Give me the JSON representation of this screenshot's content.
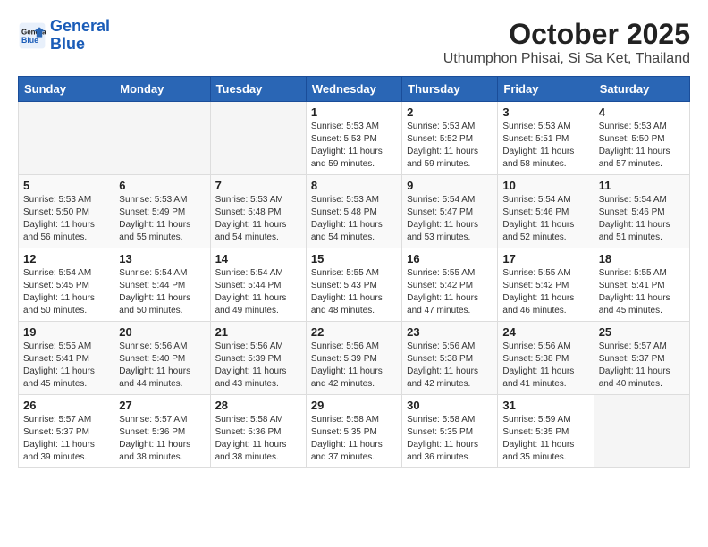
{
  "header": {
    "logo_line1": "General",
    "logo_line2": "Blue",
    "title": "October 2025",
    "subtitle": "Uthumphon Phisai, Si Sa Ket, Thailand"
  },
  "calendar": {
    "columns": [
      "Sunday",
      "Monday",
      "Tuesday",
      "Wednesday",
      "Thursday",
      "Friday",
      "Saturday"
    ],
    "weeks": [
      [
        {
          "day": "",
          "info": ""
        },
        {
          "day": "",
          "info": ""
        },
        {
          "day": "",
          "info": ""
        },
        {
          "day": "1",
          "info": "Sunrise: 5:53 AM\nSunset: 5:53 PM\nDaylight: 11 hours\nand 59 minutes."
        },
        {
          "day": "2",
          "info": "Sunrise: 5:53 AM\nSunset: 5:52 PM\nDaylight: 11 hours\nand 59 minutes."
        },
        {
          "day": "3",
          "info": "Sunrise: 5:53 AM\nSunset: 5:51 PM\nDaylight: 11 hours\nand 58 minutes."
        },
        {
          "day": "4",
          "info": "Sunrise: 5:53 AM\nSunset: 5:50 PM\nDaylight: 11 hours\nand 57 minutes."
        }
      ],
      [
        {
          "day": "5",
          "info": "Sunrise: 5:53 AM\nSunset: 5:50 PM\nDaylight: 11 hours\nand 56 minutes."
        },
        {
          "day": "6",
          "info": "Sunrise: 5:53 AM\nSunset: 5:49 PM\nDaylight: 11 hours\nand 55 minutes."
        },
        {
          "day": "7",
          "info": "Sunrise: 5:53 AM\nSunset: 5:48 PM\nDaylight: 11 hours\nand 54 minutes."
        },
        {
          "day": "8",
          "info": "Sunrise: 5:53 AM\nSunset: 5:48 PM\nDaylight: 11 hours\nand 54 minutes."
        },
        {
          "day": "9",
          "info": "Sunrise: 5:54 AM\nSunset: 5:47 PM\nDaylight: 11 hours\nand 53 minutes."
        },
        {
          "day": "10",
          "info": "Sunrise: 5:54 AM\nSunset: 5:46 PM\nDaylight: 11 hours\nand 52 minutes."
        },
        {
          "day": "11",
          "info": "Sunrise: 5:54 AM\nSunset: 5:46 PM\nDaylight: 11 hours\nand 51 minutes."
        }
      ],
      [
        {
          "day": "12",
          "info": "Sunrise: 5:54 AM\nSunset: 5:45 PM\nDaylight: 11 hours\nand 50 minutes."
        },
        {
          "day": "13",
          "info": "Sunrise: 5:54 AM\nSunset: 5:44 PM\nDaylight: 11 hours\nand 50 minutes."
        },
        {
          "day": "14",
          "info": "Sunrise: 5:54 AM\nSunset: 5:44 PM\nDaylight: 11 hours\nand 49 minutes."
        },
        {
          "day": "15",
          "info": "Sunrise: 5:55 AM\nSunset: 5:43 PM\nDaylight: 11 hours\nand 48 minutes."
        },
        {
          "day": "16",
          "info": "Sunrise: 5:55 AM\nSunset: 5:42 PM\nDaylight: 11 hours\nand 47 minutes."
        },
        {
          "day": "17",
          "info": "Sunrise: 5:55 AM\nSunset: 5:42 PM\nDaylight: 11 hours\nand 46 minutes."
        },
        {
          "day": "18",
          "info": "Sunrise: 5:55 AM\nSunset: 5:41 PM\nDaylight: 11 hours\nand 45 minutes."
        }
      ],
      [
        {
          "day": "19",
          "info": "Sunrise: 5:55 AM\nSunset: 5:41 PM\nDaylight: 11 hours\nand 45 minutes."
        },
        {
          "day": "20",
          "info": "Sunrise: 5:56 AM\nSunset: 5:40 PM\nDaylight: 11 hours\nand 44 minutes."
        },
        {
          "day": "21",
          "info": "Sunrise: 5:56 AM\nSunset: 5:39 PM\nDaylight: 11 hours\nand 43 minutes."
        },
        {
          "day": "22",
          "info": "Sunrise: 5:56 AM\nSunset: 5:39 PM\nDaylight: 11 hours\nand 42 minutes."
        },
        {
          "day": "23",
          "info": "Sunrise: 5:56 AM\nSunset: 5:38 PM\nDaylight: 11 hours\nand 42 minutes."
        },
        {
          "day": "24",
          "info": "Sunrise: 5:56 AM\nSunset: 5:38 PM\nDaylight: 11 hours\nand 41 minutes."
        },
        {
          "day": "25",
          "info": "Sunrise: 5:57 AM\nSunset: 5:37 PM\nDaylight: 11 hours\nand 40 minutes."
        }
      ],
      [
        {
          "day": "26",
          "info": "Sunrise: 5:57 AM\nSunset: 5:37 PM\nDaylight: 11 hours\nand 39 minutes."
        },
        {
          "day": "27",
          "info": "Sunrise: 5:57 AM\nSunset: 5:36 PM\nDaylight: 11 hours\nand 38 minutes."
        },
        {
          "day": "28",
          "info": "Sunrise: 5:58 AM\nSunset: 5:36 PM\nDaylight: 11 hours\nand 38 minutes."
        },
        {
          "day": "29",
          "info": "Sunrise: 5:58 AM\nSunset: 5:35 PM\nDaylight: 11 hours\nand 37 minutes."
        },
        {
          "day": "30",
          "info": "Sunrise: 5:58 AM\nSunset: 5:35 PM\nDaylight: 11 hours\nand 36 minutes."
        },
        {
          "day": "31",
          "info": "Sunrise: 5:59 AM\nSunset: 5:35 PM\nDaylight: 11 hours\nand 35 minutes."
        },
        {
          "day": "",
          "info": ""
        }
      ]
    ]
  }
}
